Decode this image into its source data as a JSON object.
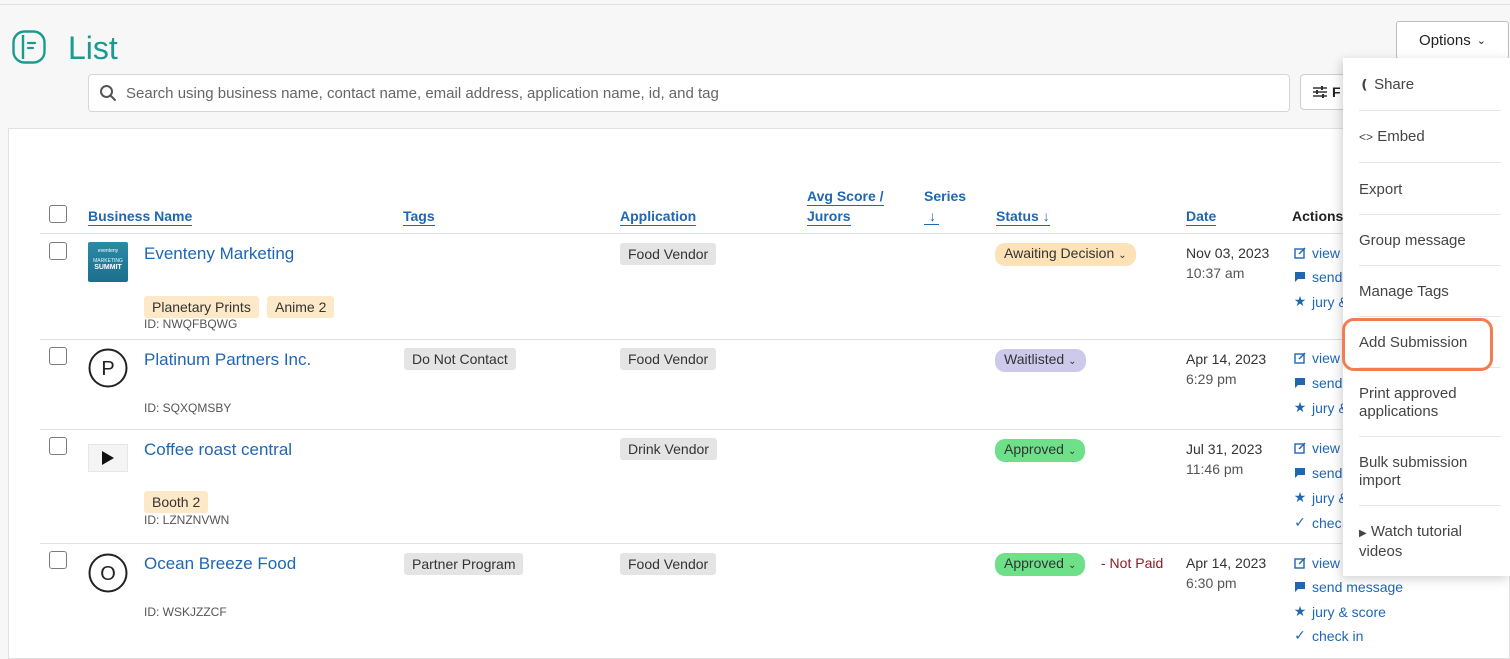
{
  "page": {
    "title": "List"
  },
  "search": {
    "placeholder": "Search using business name, contact name, email address, application name, id, and tag"
  },
  "filter": {
    "label": "F"
  },
  "options": {
    "label": "Options"
  },
  "table": {
    "columns": {
      "business_name": "Business Name",
      "tags": "Tags",
      "application": "Application",
      "avg_score_line1": "Avg Score /",
      "avg_score_line2": "Jurors",
      "series": "Series",
      "status": "Status",
      "date": "Date",
      "actions": "Actions"
    },
    "rows": [
      {
        "name": "Eventeny Marketing",
        "logo_brand": "eventeny",
        "logo_line1": "MARKETING",
        "logo_line2": "SUMMIT",
        "id": "ID: NWQFBQWG",
        "tags": [
          "Planetary Prints",
          "Anime 2"
        ],
        "application": "Food Vendor",
        "status": "Awaiting Decision",
        "date": "Nov 03, 2023",
        "time": "10:37 am",
        "actions": [
          "view",
          "send",
          "jury &"
        ]
      },
      {
        "name": "Platinum Partners Inc.",
        "avatar_letter": "P",
        "id": "ID: SQXQMSBY",
        "tag": "Do Not Contact",
        "application": "Food Vendor",
        "status": "Waitlisted",
        "date": "Apr 14, 2023",
        "time": "6:29 pm",
        "actions": [
          "view",
          "send",
          "jury &"
        ]
      },
      {
        "name": "Coffee roast central",
        "id": "ID: LZNZNVWN",
        "tags": [
          "Booth 2"
        ],
        "application": "Drink Vendor",
        "status": "Approved",
        "date": "Jul 31, 2023",
        "time": "11:46 pm",
        "actions": [
          "view",
          "send",
          "jury &",
          "chec"
        ]
      },
      {
        "name": "Ocean Breeze Food",
        "avatar_letter": "O",
        "id": "ID: WSKJZZCF",
        "tag": "Partner Program",
        "application": "Food Vendor",
        "status": "Approved",
        "payment": "- Not Paid",
        "date": "Apr 14, 2023",
        "time": "6:30 pm",
        "actions": [
          "view",
          "send message",
          "jury & score",
          "check in"
        ]
      }
    ]
  },
  "menu": {
    "share": "Share",
    "embed_prefix": "<>",
    "embed": "Embed",
    "export": "Export",
    "group_message": "Group message",
    "manage_tags": "Manage Tags",
    "add_submission": "Add Submission",
    "print_line1": "Print approved",
    "print_line2": "applications",
    "bulk_line1": "Bulk submission",
    "bulk_line2": "import",
    "watch_line1": "Watch tutorial",
    "watch_line2": "videos"
  },
  "colors": {
    "accent": "#1f66b3",
    "title": "#1a9b8f",
    "highlight": "#f37d52",
    "approved": "#6fe08a",
    "waitlisted": "#cdc9ea",
    "awaiting": "#fde2b8"
  }
}
